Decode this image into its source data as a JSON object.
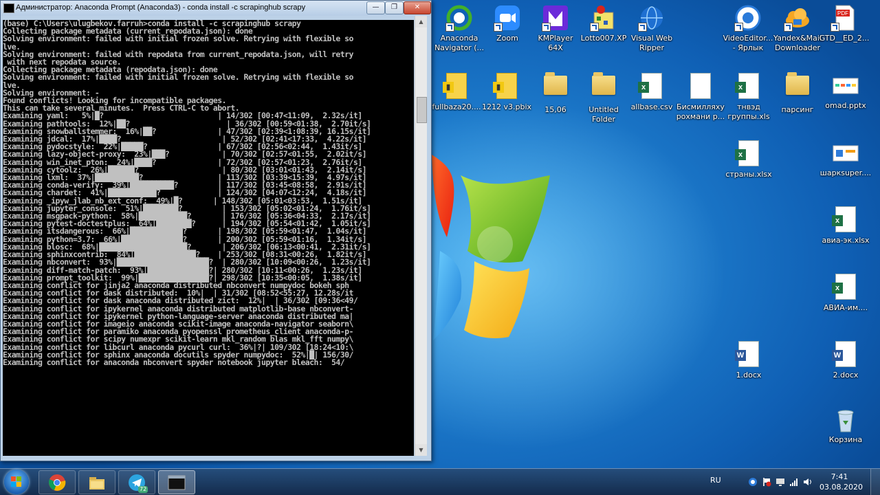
{
  "console": {
    "title": "Администратор: Anaconda Prompt (Anaconda3) - conda  install -c scrapinghub scrapy",
    "minimize_glyph": "—",
    "maximize_glyph": "❐",
    "close_glyph": "✕",
    "lines": [
      "(base) C:\\Users\\ulugbekov.farruh>conda install -c scrapinghub scrapy",
      "Collecting package metadata (current_repodata.json): done",
      "Solving environment: failed with initial frozen solve. Retrying with flexible so",
      "lve.",
      "Solving environment: failed with repodata from current_repodata.json, will retry",
      " with next repodata source.",
      "Collecting package metadata (repodata.json): done",
      "Solving environment: failed with initial frozen solve. Retrying with flexible so",
      "lve.",
      "Solving environment: -",
      "Found conflicts! Looking for incompatible packages.",
      "This can take several minutes.  Press CTRL-C to abort.",
      "Examining yaml:   5%|█?                          | 14/302 [00:47<11:09,  2.32s/it]",
      "Examining pathtools:  12%|██?                      | 36/302 [00:59<01:38,  2.70it/s]",
      "Examining snowballstemmer:  16%|██?              | 47/302 [02:39<1:08:39, 16.15s/it]",
      "Examining jdcal:  17%|████?                       | 52/302 [02:41<17:33,  4.22s/it]",
      "Examining pydocstyle:  22%|█████?                | 67/302 [02:56<02:44,  1.43it/s]",
      "Examining lazy-object-proxy:  23%|███?            | 70/302 [02:57<01:55,  2.02it/s]",
      "Examining win_inet_pton:  24%|████?              | 72/302 [02:57<01:23,  2.76it/s]",
      "Examining cytoolz:  26%|██████?                   | 80/302 [03:01<01:43,  2.14it/s]",
      "Examining lxml:  37%|██████████?                 | 113/302 [03:39<15:39,  4.97s/it]",
      "Examining conda-verify:  39%|██████████?         | 117/302 [03:45<08:58,  2.91s/it]",
      "Examining chardet:  41%|███████████?             | 124/302 [04:07<12:24,  4.18s/it]",
      "Examining _ipyw_jlab_nb_ext_conf:  49%|█?       | 148/302 [05:01<03:53,  1.51s/it]",
      "Examining jupyter_console:  51%|████████?         | 153/302 [05:02<01:24,  1.76it/s]",
      "Examining msgpack-python:  58%|███████████?       | 176/302 [05:36<04:33,  2.17s/it]",
      "Examining pytest-doctestplus:  64%|████████?      | 194/302 [05:54<01:42,  1.05it/s]",
      "Examining itsdangerous:  66%|████████████?       | 198/302 [05:59<01:47,  1.04s/it]",
      "Examining python=3.7:  66%|██████████████?       | 200/302 [05:59<01:16,  1.34it/s]",
      "Examining blosc:  68%|████████████████████?       | 206/302 [06:13<00:41,  2.31it/s]",
      "Examining sphinxcontrib:  84%|██████████████?    | 253/302 [08:31<00:26,  1.82it/s]",
      "Examining nbconvert:  93%|█████████████████████?  | 280/302 [10:09<00:26,  1.23s/it]",
      "Examining diff-match-patch:  93%|██████████████?| 280/302 [10:11<00:26,  1.23s/it]",
      "Examining prompt_toolkit:  99%|████████████████?| 298/302 [10:35<00:05,  1.38s/it]",
      "Examining conflict for jinja2 anaconda distributed nbconvert numpydoc bokeh sph",
      "Examining conflict for dask distributed:  10%|  | 31/302 [08:52<55:27, 12.28s/it",
      "Examining conflict for dask anaconda distributed zict:  12%|  | 36/302 [09:36<49/",
      "Examining conflict for ipykernel anaconda distributed matplotlib-base nbconvert-",
      "Examining conflict for ipykernel python-language-server anaconda distributed ma|",
      "Examining conflict for imageio anaconda scikit-image anaconda-navigator seaborn\\",
      "Examining conflict for paramiko anaconda pyopenssl prometheus_client anaconda-p-",
      "Examining conflict for scipy numexpr scikit-learn mkl_random blas mkl_fft numpy\\",
      "Examining conflict for libcurl anaconda pycurl curl:  36%|?| 109/302 [18:24<10:\\",
      "Examining conflict for sphinx anaconda docutils spyder numpydoc:  52%|█| 156/30/",
      "Examining conflict for anaconda nbconvert spyder notebook jupyter bleach:  54/"
    ]
  },
  "desktop_icons": [
    {
      "label": "Anaconda\nNavigator (..."
    },
    {
      "label": "Zoom"
    },
    {
      "label": "KMPlayer\n64X"
    },
    {
      "label": "Lotto007.XP"
    },
    {
      "label": "Visual Web\nRipper"
    },
    {
      "label": "VideoEditor...\n- Ярлык"
    },
    {
      "label": "Yandex&Mail\nDownloader"
    },
    {
      "label": "GTD__ED_2..."
    },
    {
      "label": "fullbaza20...."
    },
    {
      "label": "1212 v3.pbix"
    },
    {
      "label": "15,06"
    },
    {
      "label": "Untitled\nFolder"
    },
    {
      "label": "allbase.csv"
    },
    {
      "label": "Бисмилляху\nрохмани р..."
    },
    {
      "label": "тнвэд\nгруппы.xls"
    },
    {
      "label": "парсинг"
    },
    {
      "label": "omad.pptx"
    },
    {
      "label": "страны.xlsx"
    },
    {
      "label": "шаркsuper...."
    },
    {
      "label": "авиа-эк.xlsx"
    },
    {
      "label": "АВИА-им...."
    },
    {
      "label": "1.docx"
    },
    {
      "label": "2.docx"
    },
    {
      "label": "Корзина"
    }
  ],
  "taskbar": {
    "telegram_badge": "72",
    "language": "RU",
    "time": "7:41",
    "date": "03.08.2020"
  }
}
